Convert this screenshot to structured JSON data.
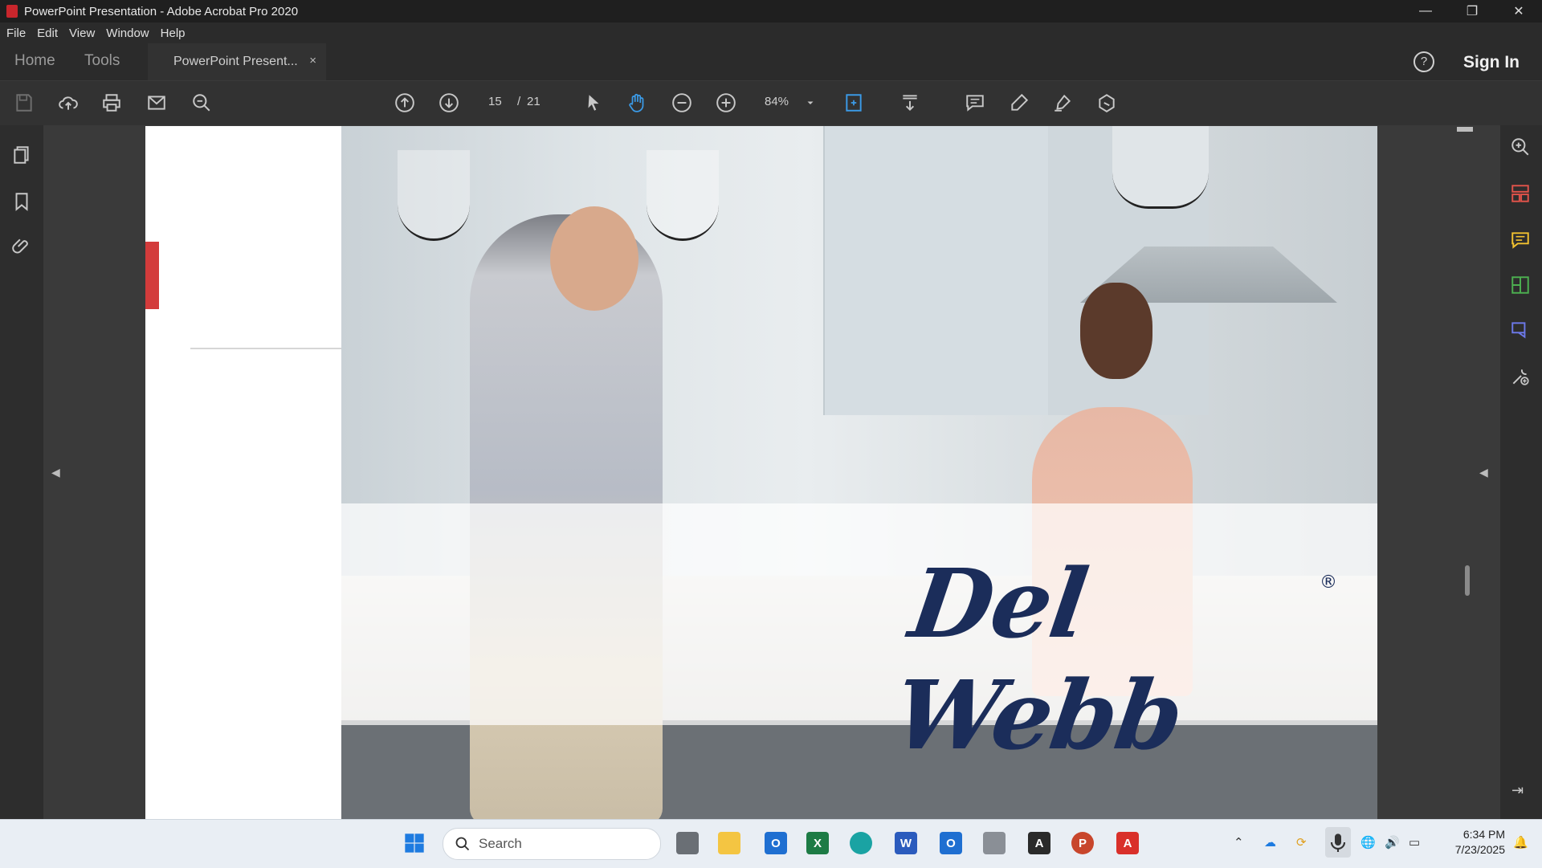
{
  "window": {
    "title": "PowerPoint Presentation - Adobe Acrobat Pro 2020",
    "minimize": "—",
    "restore": "❐",
    "close": "✕"
  },
  "menu": [
    "File",
    "Edit",
    "View",
    "Window",
    "Help"
  ],
  "tabs": {
    "home": "Home",
    "tools": "Tools",
    "document": "PowerPoint Present...",
    "close": "×"
  },
  "header": {
    "help": "?",
    "sign_in": "Sign In"
  },
  "toolbar": {
    "page_current": "15",
    "page_sep": "/",
    "page_total": "21",
    "zoom": "84%"
  },
  "slide": {
    "logo_text": "Del Webb",
    "registered": "®"
  },
  "taskbar": {
    "search_placeholder": "Search",
    "time": "6:34 PM",
    "date": "7/23/2025"
  },
  "colors": {
    "accent_red": "#d33b3b",
    "logo_navy": "#1b2d5a",
    "hand_tool_blue": "#3b9be8"
  }
}
